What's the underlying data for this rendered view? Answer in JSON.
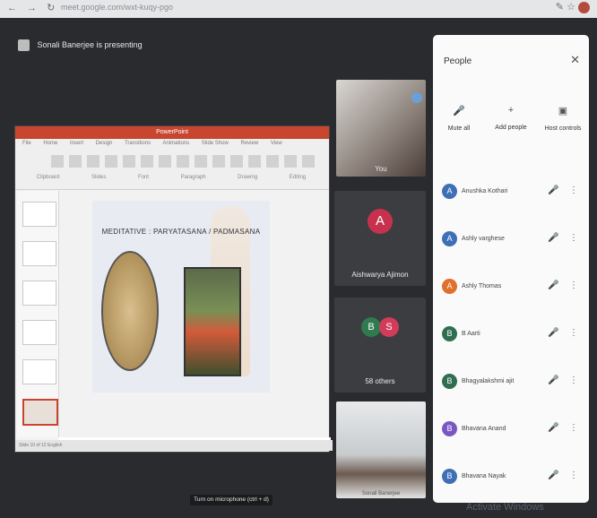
{
  "browser": {
    "url": "meet.google.com/wxt-kuqy-pgo",
    "nav_icons": "← → ↻",
    "right_icons": "✎ ☆"
  },
  "meeting": {
    "presenter_text": "Sonali Banerjee is presenting",
    "caption_button": "Turn on microphone (ctrl + d)",
    "watermark": "Activate Windows"
  },
  "presentation": {
    "window_title": "PowerPoint",
    "tabs": [
      "File",
      "Home",
      "Insert",
      "Design",
      "Transitions",
      "Animations",
      "Slide Show",
      "Review",
      "View"
    ],
    "groups": [
      "Clipboard",
      "Slides",
      "Font",
      "Paragraph",
      "Drawing",
      "Editing"
    ],
    "slide_title": "MEDITATIVE : PARYATASANA / PADMASANA",
    "notes_placeholder": "Click to add notes",
    "status": "Slide 10 of 12   English"
  },
  "tiles": {
    "self_label": "You",
    "user1": {
      "name": "Aishwarya Ajimon",
      "initial": "A",
      "color": "#c6324d"
    },
    "others": {
      "label": "58 others",
      "initial1": "B",
      "initial2": "S",
      "color1": "#2f7a4e",
      "color2": "#d23c5a"
    },
    "presenter_label": "Sonali Banerjee"
  },
  "people_panel": {
    "title": "People",
    "actions": [
      "Mute all",
      "Add people",
      "Host controls"
    ],
    "participants": [
      {
        "name": "Anushka Kothari",
        "initial": "A",
        "color": "#3f6fb5"
      },
      {
        "name": "Ashly varghese",
        "initial": "A",
        "color": "#3f6fb5"
      },
      {
        "name": "Ashly Thomas",
        "initial": "A",
        "color": "#e0702c"
      },
      {
        "name": "B Aarti",
        "initial": "B",
        "color": "#2f6e50"
      },
      {
        "name": "Bhagyalakshmi ajit",
        "initial": "B",
        "color": "#2f6e50"
      },
      {
        "name": "Bhavana Anand",
        "initial": "B",
        "color": "#7a58c2"
      },
      {
        "name": "Bhavana Nayak",
        "initial": "B",
        "color": "#3f6fb5"
      }
    ]
  }
}
